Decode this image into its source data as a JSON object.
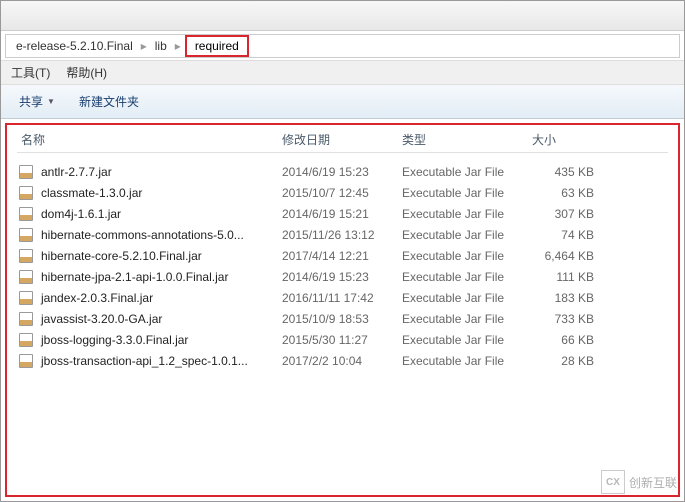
{
  "breadcrumb": {
    "part1": "e-release-5.2.10.Final",
    "part2": "lib",
    "part3": "required"
  },
  "menu": {
    "tools": "工具(T)",
    "help": "帮助(H)"
  },
  "toolbar": {
    "share": "共享",
    "new_folder": "新建文件夹"
  },
  "headers": {
    "name": "名称",
    "date": "修改日期",
    "type": "类型",
    "size": "大小"
  },
  "files": [
    {
      "name": "antlr-2.7.7.jar",
      "date": "2014/6/19 15:23",
      "type": "Executable Jar File",
      "size": "435 KB"
    },
    {
      "name": "classmate-1.3.0.jar",
      "date": "2015/10/7 12:45",
      "type": "Executable Jar File",
      "size": "63 KB"
    },
    {
      "name": "dom4j-1.6.1.jar",
      "date": "2014/6/19 15:21",
      "type": "Executable Jar File",
      "size": "307 KB"
    },
    {
      "name": "hibernate-commons-annotations-5.0...",
      "date": "2015/11/26 13:12",
      "type": "Executable Jar File",
      "size": "74 KB"
    },
    {
      "name": "hibernate-core-5.2.10.Final.jar",
      "date": "2017/4/14 12:21",
      "type": "Executable Jar File",
      "size": "6,464 KB"
    },
    {
      "name": "hibernate-jpa-2.1-api-1.0.0.Final.jar",
      "date": "2014/6/19 15:23",
      "type": "Executable Jar File",
      "size": "111 KB"
    },
    {
      "name": "jandex-2.0.3.Final.jar",
      "date": "2016/11/11 17:42",
      "type": "Executable Jar File",
      "size": "183 KB"
    },
    {
      "name": "javassist-3.20.0-GA.jar",
      "date": "2015/10/9 18:53",
      "type": "Executable Jar File",
      "size": "733 KB"
    },
    {
      "name": "jboss-logging-3.3.0.Final.jar",
      "date": "2015/5/30 11:27",
      "type": "Executable Jar File",
      "size": "66 KB"
    },
    {
      "name": "jboss-transaction-api_1.2_spec-1.0.1...",
      "date": "2017/2/2 10:04",
      "type": "Executable Jar File",
      "size": "28 KB"
    }
  ],
  "watermark": {
    "logo": "CX",
    "text": "创新互联"
  }
}
